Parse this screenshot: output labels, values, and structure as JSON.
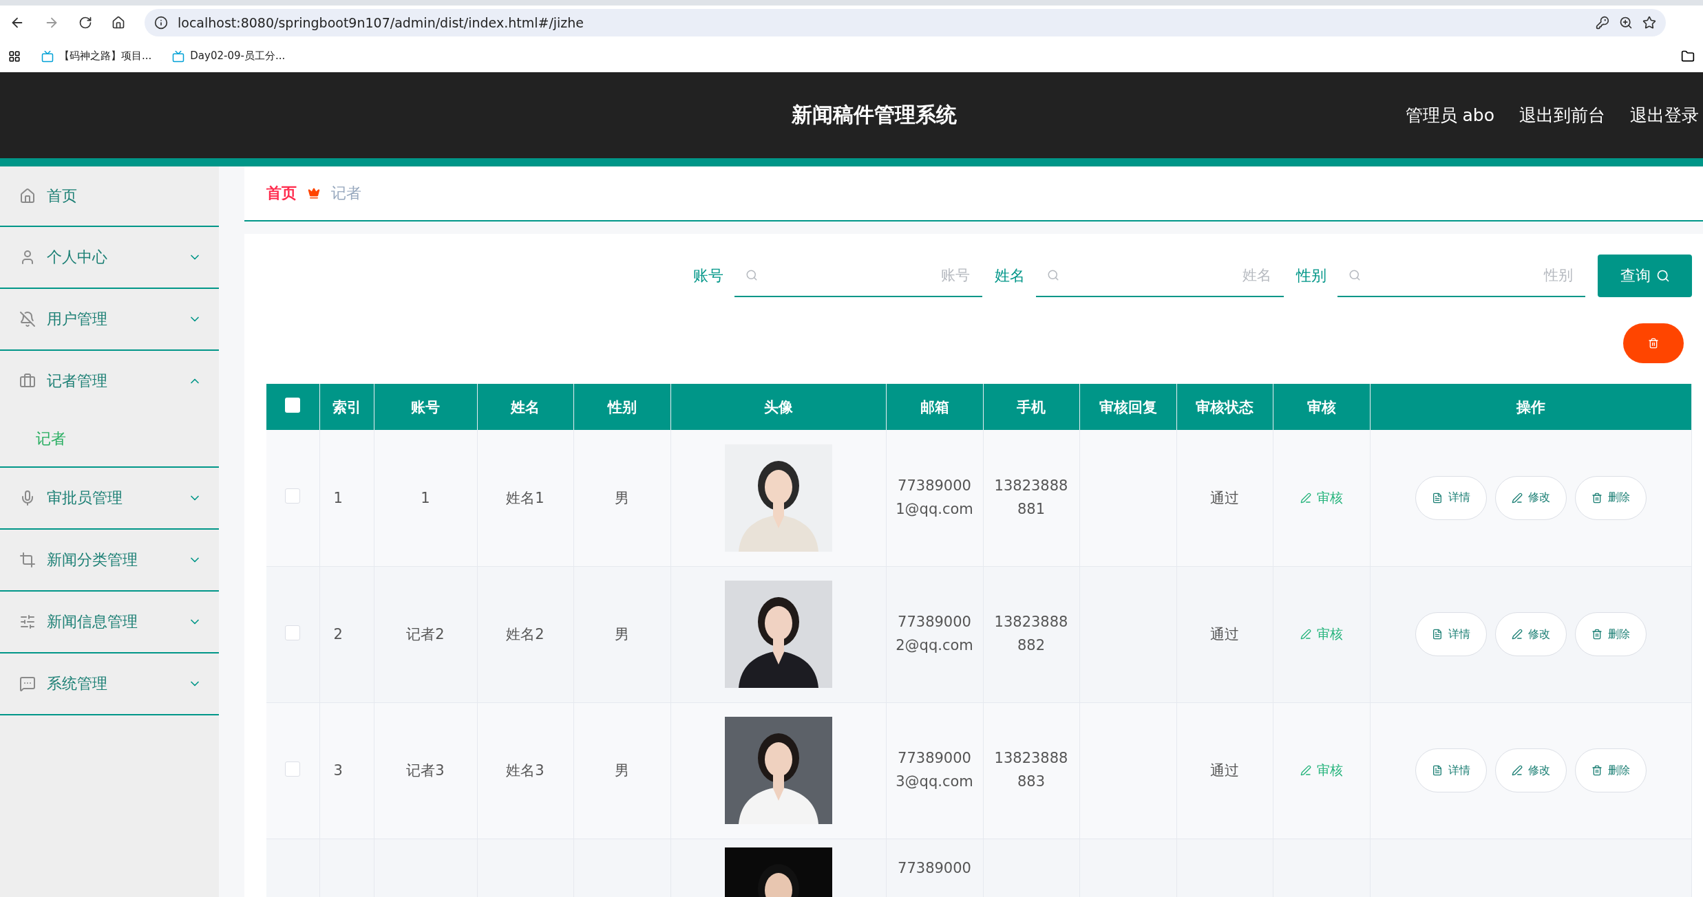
{
  "browser": {
    "url": "localhost:8080/springboot9n107/admin/dist/index.html#/jizhe",
    "bookmarks": [
      {
        "label": "【码神之路】项目..."
      },
      {
        "label": "Day02-09-员工分..."
      }
    ]
  },
  "header": {
    "title": "新闻稿件管理系统",
    "links": [
      "管理员 abo",
      "退出到前台",
      "退出登录"
    ]
  },
  "sidebar": {
    "items": [
      {
        "label": "首页",
        "kind": "link"
      },
      {
        "label": "个人中心",
        "kind": "menu",
        "expanded": false
      },
      {
        "label": "用户管理",
        "kind": "menu",
        "expanded": false
      },
      {
        "label": "记者管理",
        "kind": "menu",
        "expanded": true,
        "children": [
          {
            "label": "记者",
            "selected": true
          }
        ]
      },
      {
        "label": "审批员管理",
        "kind": "menu",
        "expanded": false
      },
      {
        "label": "新闻分类管理",
        "kind": "menu",
        "expanded": false
      },
      {
        "label": "新闻信息管理",
        "kind": "menu",
        "expanded": false
      },
      {
        "label": "系统管理",
        "kind": "menu",
        "expanded": false
      }
    ]
  },
  "breadcrumb": [
    "首页",
    "记者"
  ],
  "search": {
    "fields": [
      {
        "label": "账号",
        "placeholder": "账号"
      },
      {
        "label": "姓名",
        "placeholder": "姓名"
      },
      {
        "label": "性别",
        "placeholder": "性别"
      }
    ],
    "button": "查询"
  },
  "table": {
    "all_checked": false,
    "columns": [
      "索引",
      "账号",
      "姓名",
      "性别",
      "头像",
      "邮箱",
      "手机",
      "审核回复",
      "审核状态",
      "审核",
      "操作"
    ],
    "rows": [
      {
        "kind": "full",
        "checked": false,
        "index": "1",
        "account": "1",
        "name": "姓名1",
        "gender": "男",
        "photo": {
          "kind": "picture"
        },
        "email": "773890001@qq.com",
        "phone": "13823888881",
        "status": "通过",
        "review": "审核",
        "actions": [
          "详情",
          "修改",
          "删除"
        ]
      },
      {
        "kind": "full",
        "checked": false,
        "index": "2",
        "account": "记者2",
        "name": "姓名2",
        "gender": "男",
        "photo": {
          "kind": "picture"
        },
        "email": "773890002@qq.com",
        "phone": "13823888882",
        "status": "通过",
        "review": "审核",
        "actions": [
          "详情",
          "修改",
          "删除"
        ]
      },
      {
        "kind": "full",
        "checked": false,
        "index": "3",
        "account": "记者3",
        "name": "姓名3",
        "gender": "男",
        "photo": {
          "kind": "picture"
        },
        "email": "773890003@qq.com",
        "phone": "13823888883",
        "status": "通过",
        "review": "审核",
        "actions": [
          "详情",
          "修改",
          "删除"
        ]
      },
      {
        "kind": "partial",
        "photo": {
          "kind": "picture"
        },
        "email": "77389000"
      }
    ]
  }
}
